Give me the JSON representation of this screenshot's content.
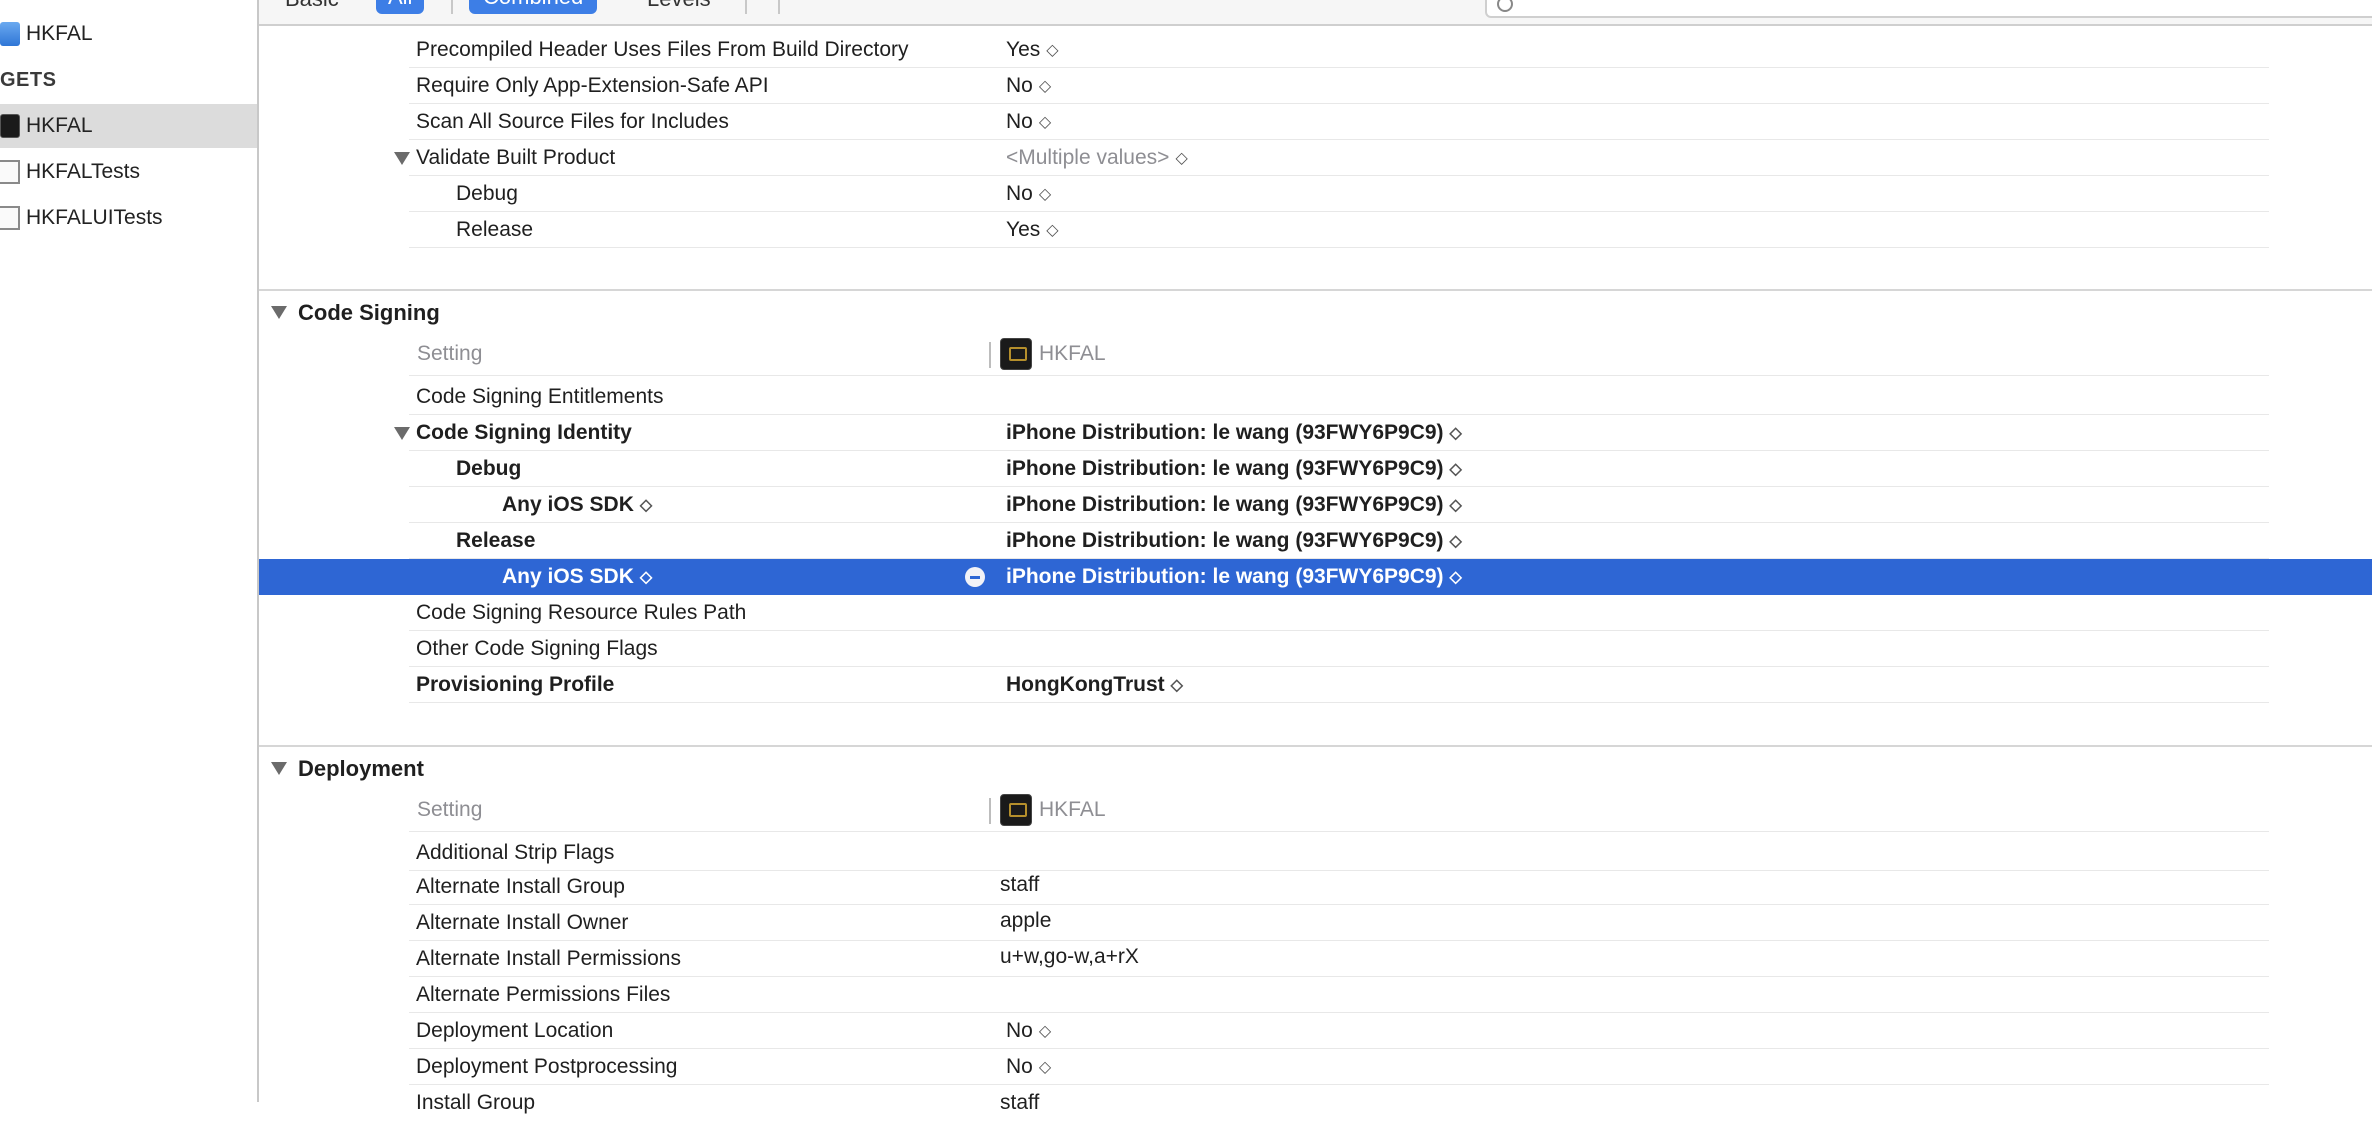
{
  "sidebar": {
    "project": "HKFAL",
    "targets_heading": "GETS",
    "targets": [
      "HKFAL",
      "HKFALTests",
      "HKFALUITests"
    ]
  },
  "toolbar": {
    "basic": "Basic",
    "all": "All",
    "combined": "Combined",
    "levels": "Levels"
  },
  "stepper_glyph": "◇",
  "packaging": {
    "rows": [
      {
        "name": "Precompiled Header Uses Files From Build Directory",
        "value": "Yes"
      },
      {
        "name": "Require Only App-Extension-Safe API",
        "value": "No"
      },
      {
        "name": "Scan All Source Files for Includes",
        "value": "No"
      },
      {
        "name": "Validate Built Product",
        "value": "<Multiple values>"
      },
      {
        "name": "Debug",
        "value": "No"
      },
      {
        "name": "Release",
        "value": "Yes"
      }
    ]
  },
  "code_signing": {
    "title": "Code Signing",
    "setting_label": "Setting",
    "target_name": "HKFAL",
    "rows": [
      {
        "name": "Code Signing Entitlements",
        "value": ""
      },
      {
        "name": "Code Signing Identity",
        "value": "iPhone Distribution: le wang (93FWY6P9C9)"
      },
      {
        "name": "Debug",
        "value": "iPhone Distribution: le wang (93FWY6P9C9)"
      },
      {
        "name": "Any iOS SDK",
        "value": "iPhone Distribution: le wang (93FWY6P9C9)"
      },
      {
        "name": "Release",
        "value": "iPhone Distribution: le wang (93FWY6P9C9)"
      },
      {
        "name": "Any iOS SDK",
        "value": "iPhone Distribution: le wang (93FWY6P9C9)"
      },
      {
        "name": "Code Signing Resource Rules Path",
        "value": ""
      },
      {
        "name": "Other Code Signing Flags",
        "value": ""
      },
      {
        "name": "Provisioning Profile",
        "value": "HongKongTrust"
      }
    ]
  },
  "deployment": {
    "title": "Deployment",
    "setting_label": "Setting",
    "target_name": "HKFAL",
    "rows": [
      {
        "name": "Additional Strip Flags",
        "value": ""
      },
      {
        "name": "Alternate Install Group",
        "value": "staff"
      },
      {
        "name": "Alternate Install Owner",
        "value": "apple"
      },
      {
        "name": "Alternate Install Permissions",
        "value": "u+w,go-w,a+rX"
      },
      {
        "name": "Alternate Permissions Files",
        "value": ""
      },
      {
        "name": "Deployment Location",
        "value": "No"
      },
      {
        "name": "Deployment Postprocessing",
        "value": "No"
      },
      {
        "name": "Install Group",
        "value": "staff"
      }
    ]
  },
  "colors": {
    "selection": "#2e66d4",
    "accent": "#3d7ee6"
  }
}
